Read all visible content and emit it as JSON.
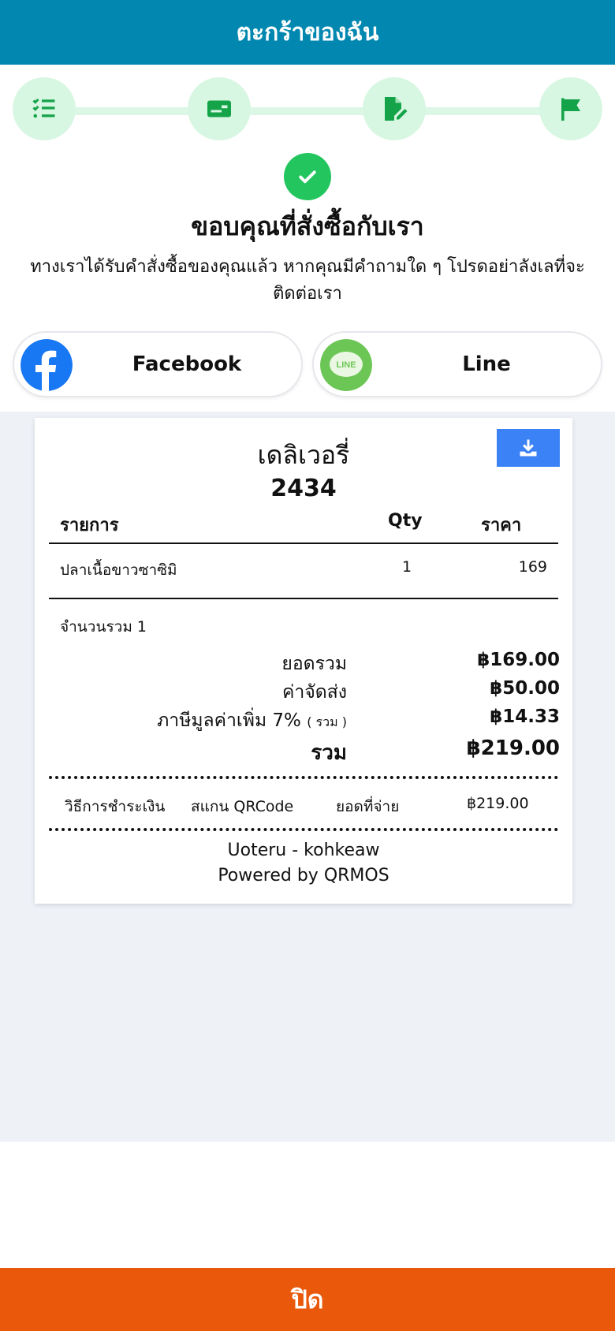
{
  "header": {
    "title": "ตะกร้าของฉัน"
  },
  "steps": [
    {
      "icon": "checklist-icon"
    },
    {
      "icon": "id-card-icon"
    },
    {
      "icon": "document-edit-icon"
    },
    {
      "icon": "flag-icon"
    }
  ],
  "confirmation": {
    "title": "ขอบคุณที่สั่งซื้อกับเรา",
    "message": "ทางเราได้รับคำสั่งซื้อของคุณแล้ว หากคุณมีคำถามใด ๆ โปรดอย่าลังเลที่จะติดต่อเรา"
  },
  "social": {
    "facebook_label": "Facebook",
    "line_label": "Line",
    "line_logo_text": "LINE"
  },
  "receipt": {
    "title": "เดลิเวอรี่",
    "order_number": "2434",
    "columns": {
      "item": "รายการ",
      "qty": "Qty",
      "price": "ราคา"
    },
    "items": [
      {
        "name": "ปลาเนื้อขาวซาซิมิ",
        "qty": "1",
        "price": "169"
      }
    ],
    "count_label": "จำนวนรวม 1",
    "subtotal_label": "ยอดรวม",
    "subtotal_value": "฿169.00",
    "delivery_label": "ค่าจัดส่ง",
    "delivery_value": "฿50.00",
    "vat_label": "ภาษีมูลค่าเพิ่ม 7%",
    "vat_note": "( รวม )",
    "vat_value": "฿14.33",
    "total_label": "รวม",
    "total_value": "฿219.00",
    "payment_method_label": "วิธีการชำระเงิน",
    "payment_method_value": "สแกน QRCode",
    "paid_label": "ยอดที่จ่าย",
    "paid_value": "฿219.00",
    "footer_store": "Uoteru - kohkeaw",
    "footer_powered": "Powered by QRMOS"
  },
  "close_button": {
    "label": "ปิด"
  },
  "colors": {
    "header": "#0288b0",
    "step_bg": "#d8f7e2",
    "step_icon": "#15a34a",
    "success": "#22c55e",
    "facebook": "#1877f2",
    "line": "#6cc655",
    "download": "#3b82f6",
    "close": "#ea580c",
    "panel": "#eef2f7"
  }
}
